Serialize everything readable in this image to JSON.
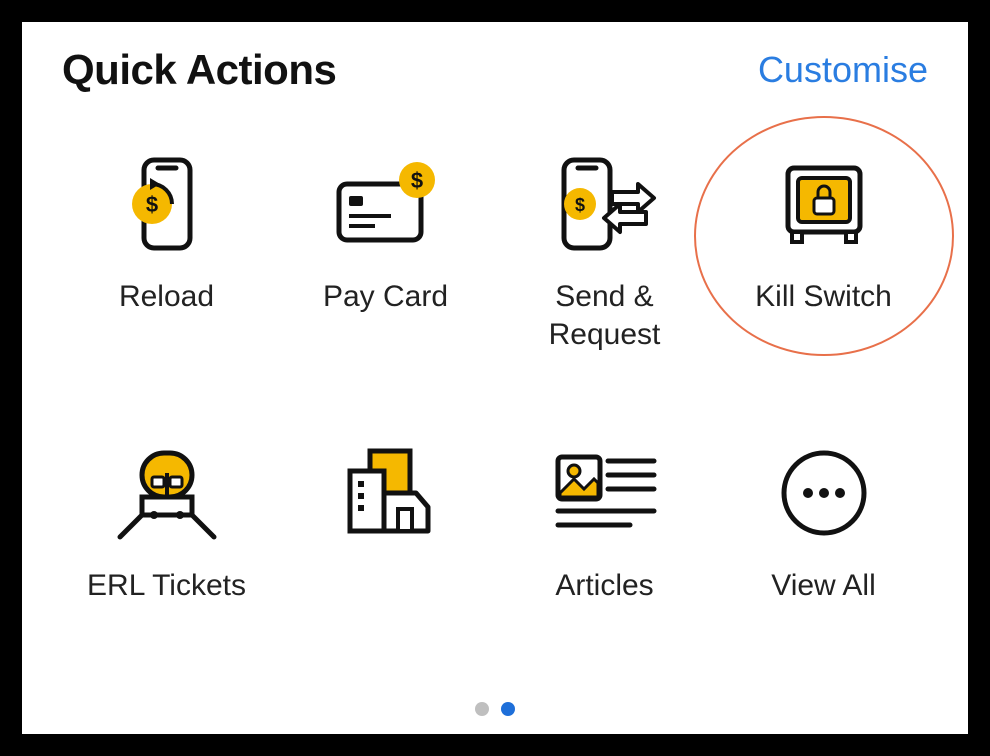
{
  "header": {
    "title": "Quick Actions",
    "customise": "Customise"
  },
  "tiles": [
    {
      "label": "Reload"
    },
    {
      "label": "Pay Card"
    },
    {
      "label": "Send & Request"
    },
    {
      "label": "Kill Switch"
    },
    {
      "label": "ERL Tickets"
    },
    {
      "label": ""
    },
    {
      "label": "Articles"
    },
    {
      "label": "View All"
    }
  ],
  "pager": {
    "total": 2,
    "active_index": 1
  },
  "highlighted_tile_index": 3
}
